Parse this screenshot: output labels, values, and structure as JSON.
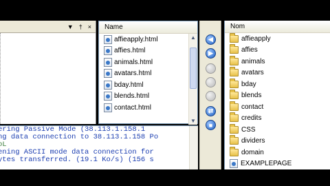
{
  "left_pane": {
    "controls": [
      "▼",
      "†",
      "×"
    ]
  },
  "local_list": {
    "header": "Name",
    "files": [
      "affieapply.html",
      "affies.html",
      "animals.html",
      "avatars.html",
      "bday.html",
      "blends.html",
      "contact.html"
    ]
  },
  "remote_list": {
    "header": "Nom",
    "items": [
      {
        "label": "affieapply",
        "type": "folder"
      },
      {
        "label": "affies",
        "type": "folder"
      },
      {
        "label": "animals",
        "type": "folder"
      },
      {
        "label": "avatars",
        "type": "folder"
      },
      {
        "label": "bday",
        "type": "folder"
      },
      {
        "label": "blends",
        "type": "folder"
      },
      {
        "label": "contact",
        "type": "folder"
      },
      {
        "label": "credits",
        "type": "folder"
      },
      {
        "label": "CSS",
        "type": "folder"
      },
      {
        "label": "dividers",
        "type": "folder"
      },
      {
        "label": "domain",
        "type": "folder"
      },
      {
        "label": "EXAMPLEPAGE",
        "type": "file"
      }
    ]
  },
  "log": {
    "lines": [
      {
        "text": "ering Passive Mode (38.113.1.158.1",
        "color": "blue"
      },
      {
        "text": "ng data connection to 38.113.1.158 Po",
        "color": "blue"
      },
      {
        "text": "oL",
        "color": "green"
      },
      {
        "text": "ening ASCII mode data connection for",
        "color": "blue"
      },
      {
        "text": "ytes transferred. (19.1 Ko/s) (156 s",
        "color": "blue"
      }
    ]
  },
  "transfer_buttons": [
    {
      "icon": "upload-icon",
      "style": "blue"
    },
    {
      "icon": "download-icon",
      "style": "blue"
    },
    {
      "icon": "disabled-icon",
      "style": "grey"
    },
    {
      "icon": "disabled-icon",
      "style": "grey"
    },
    {
      "icon": "disabled-icon",
      "style": "grey"
    },
    {
      "icon": "sync-icon",
      "style": "blue"
    },
    {
      "icon": "stop-icon",
      "style": "blue"
    }
  ],
  "colors": {
    "selection": "#316ac5",
    "log_blue": "#1a3db0",
    "log_green": "#3a7d3a"
  }
}
